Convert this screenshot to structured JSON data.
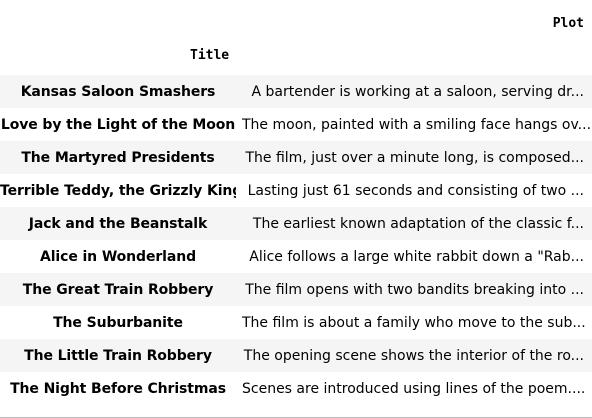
{
  "table": {
    "headers": {
      "title": "Title",
      "plot": "Plot"
    },
    "rows": [
      {
        "title": "Kansas Saloon Smashers",
        "plot": "A bartender is working at a saloon, serving dr..."
      },
      {
        "title": "Love by the Light of the Moon",
        "plot": "The moon, painted with a smiling face hangs ov..."
      },
      {
        "title": "The Martyred Presidents",
        "plot": "The film, just over a minute long, is composed..."
      },
      {
        "title": "Terrible Teddy, the Grizzly King",
        "plot": "Lasting just 61 seconds and consisting of two ..."
      },
      {
        "title": "Jack and the Beanstalk",
        "plot": "The earliest known adaptation of the classic f..."
      },
      {
        "title": "Alice in Wonderland",
        "plot": "Alice follows a large white rabbit down a \"Rab..."
      },
      {
        "title": "The Great Train Robbery",
        "plot": "The film opens with two bandits breaking into ..."
      },
      {
        "title": "The Suburbanite",
        "plot": "The film is about a family who move to the sub..."
      },
      {
        "title": "The Little Train Robbery",
        "plot": "The opening scene shows the interior of the ro..."
      },
      {
        "title": "The Night Before Christmas",
        "plot": "Scenes are introduced using lines of the poem...."
      }
    ]
  }
}
